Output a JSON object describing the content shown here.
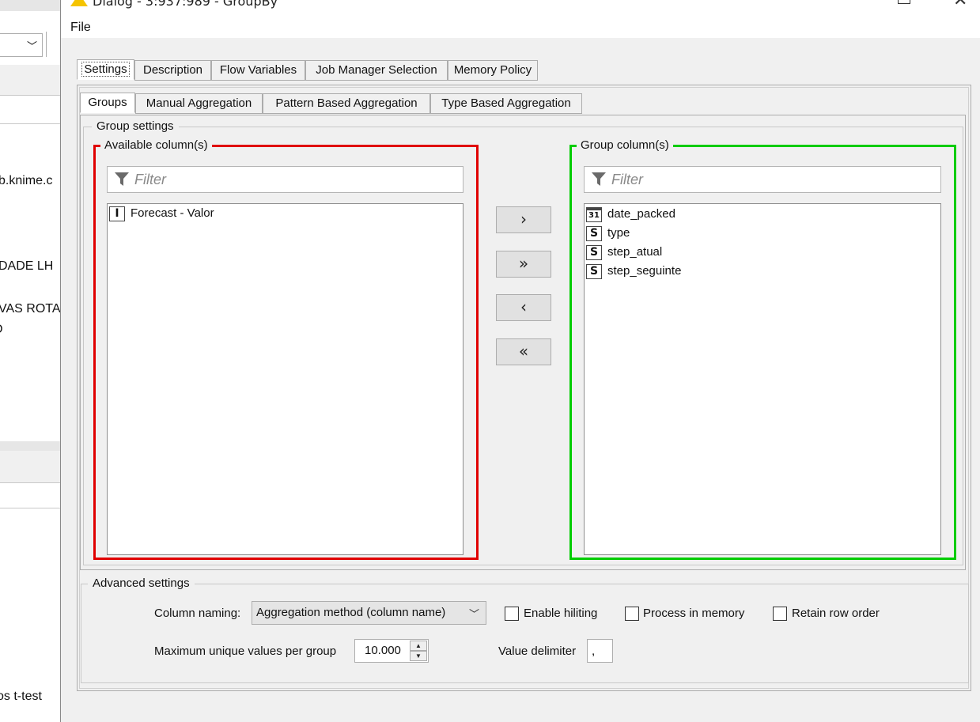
{
  "background_app": {
    "texts": [
      "b.knime.c",
      "DADE LH",
      "VAS ROTA",
      "D",
      "os t-test"
    ]
  },
  "window": {
    "title": "Dialog - 3:937:989 - GroupBy",
    "menu": [
      "File"
    ]
  },
  "outer_tabs": [
    "Settings",
    "Description",
    "Flow Variables",
    "Job Manager Selection",
    "Memory Policy"
  ],
  "inner_tabs": [
    "Groups",
    "Manual Aggregation",
    "Pattern Based Aggregation",
    "Type Based Aggregation"
  ],
  "group_settings": {
    "title": "Group settings",
    "available": {
      "title": "Available column(s)",
      "filter_placeholder": "Filter",
      "border_color": "#e00000",
      "items": [
        {
          "type_icon": "I",
          "label": "Forecast - Valor"
        }
      ]
    },
    "selected": {
      "title": "Group column(s)",
      "filter_placeholder": "Filter",
      "border_color": "#00cc00",
      "items": [
        {
          "type_icon": "31",
          "label": "date_packed"
        },
        {
          "type_icon": "S",
          "label": "type"
        },
        {
          "type_icon": "S",
          "label": "step_atual"
        },
        {
          "type_icon": "S",
          "label": "step_seguinte"
        }
      ]
    },
    "buttons": {
      "add": "›",
      "add_all": "»",
      "remove": "‹",
      "remove_all": "«"
    }
  },
  "advanced_settings": {
    "title": "Advanced settings",
    "column_naming_label": "Column naming:",
    "column_naming_value": "Aggregation method (column name)",
    "enable_hiliting": {
      "label": "Enable hiliting",
      "checked": false
    },
    "process_in_memory": {
      "label": "Process in memory",
      "checked": false
    },
    "retain_row_order": {
      "label": "Retain row order",
      "checked": false
    },
    "max_unique_label": "Maximum unique values per group",
    "max_unique_value": "10.000",
    "value_delimiter_label": "Value delimiter",
    "value_delimiter_value": ","
  }
}
